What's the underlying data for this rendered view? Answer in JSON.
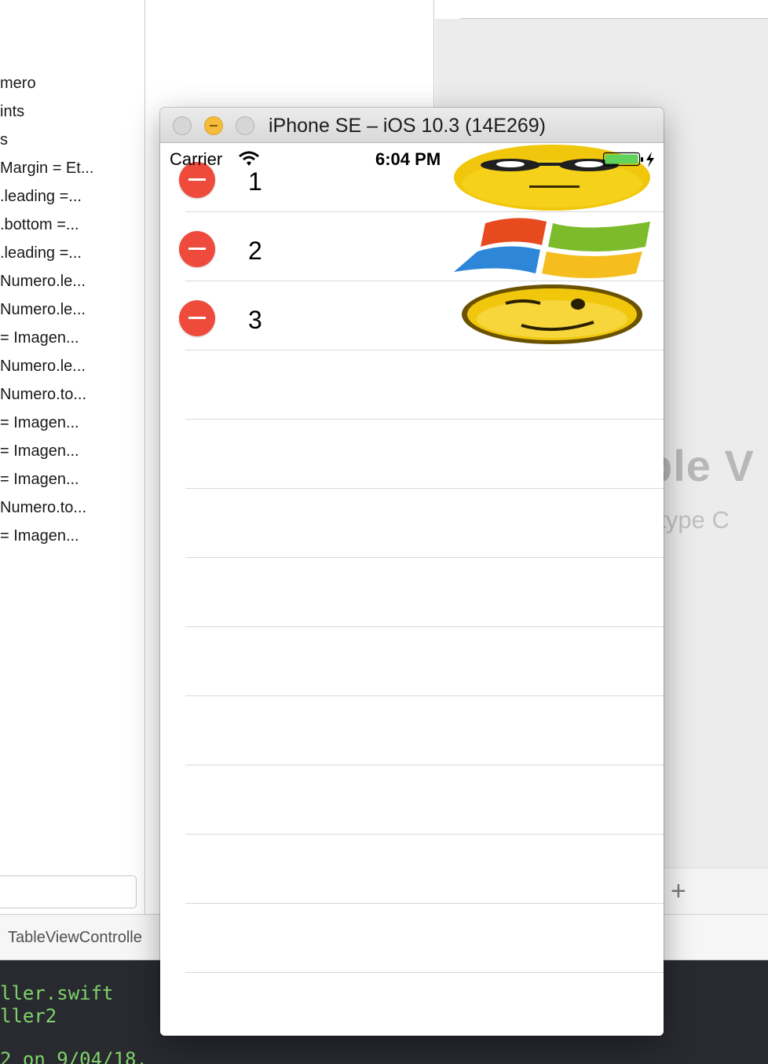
{
  "outline": {
    "items": [
      "mero",
      "ints",
      "s",
      "Margin = Et...",
      ".leading =...",
      ".bottom =...",
      ".leading =...",
      "Numero.le...",
      "Numero.le...",
      "= Imagen...",
      "Numero.le...",
      "Numero.to...",
      "= Imagen...",
      "= Imagen...",
      "= Imagen...",
      "Numero.to...",
      "= Imagen..."
    ]
  },
  "canvas": {
    "title": "ble V",
    "subtitle": "otype C",
    "add_label": "+"
  },
  "jumpbar": {
    "label": "TableViewControlle"
  },
  "editor": {
    "lines": [
      "ller.swift",
      "ller2",
      "2 on 9/04/18."
    ]
  },
  "simulator": {
    "title": "iPhone SE – iOS 10.3 (14E269)",
    "status_bar": {
      "carrier": "Carrier",
      "time": "6:04 PM"
    },
    "rows": [
      {
        "number": "1",
        "image": "sunglasses-smiley-icon"
      },
      {
        "number": "2",
        "image": "windows-logo-icon"
      },
      {
        "number": "3",
        "image": "winking-smiley-icon"
      }
    ],
    "colors": {
      "delete": "#ee4b3d",
      "battery": "#5fd35a",
      "minimize": "#f5bc3a"
    }
  }
}
